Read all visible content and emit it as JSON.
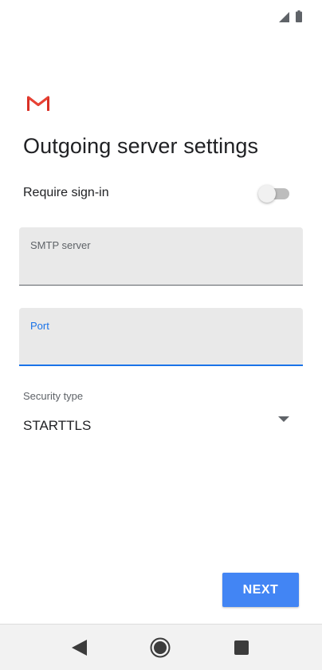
{
  "status_bar": {
    "icons": [
      "signal-icon",
      "battery-icon"
    ]
  },
  "app": {
    "logo": "gmail-logo",
    "brand_color": "#d93025"
  },
  "page": {
    "title": "Outgoing server settings"
  },
  "require_signin": {
    "label": "Require sign-in",
    "enabled": false
  },
  "smtp_server": {
    "label": "SMTP server",
    "value": ""
  },
  "port": {
    "label": "Port",
    "value": "",
    "focused": true,
    "focus_color": "#1a73e8"
  },
  "security": {
    "label": "Security type",
    "selected": "STARTTLS",
    "icon": "dropdown-arrow-icon"
  },
  "actions": {
    "next_label": "NEXT",
    "next_color": "#4285f4"
  },
  "nav_bar": {
    "icons": [
      "back-icon",
      "home-icon",
      "recents-icon"
    ]
  }
}
